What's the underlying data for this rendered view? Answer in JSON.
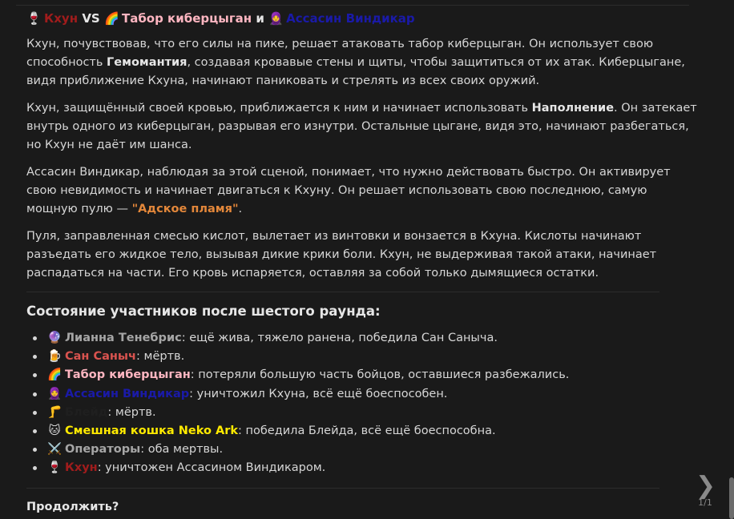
{
  "header": {
    "icon1": "🍷",
    "name1": "Кхун",
    "vs": "VS",
    "icon2": "🌈",
    "name2": "Табор киберцыган",
    "and": "и",
    "icon3": "🧕",
    "name3": "Ассасин Виндикар"
  },
  "paragraphs": {
    "p1_a": "Кхун, почувствовав, что его силы на пике, решает атаковать табор киберцыган. Он использует свою способность ",
    "p1_b": "Гемомантия",
    "p1_c": ", создавая кровавые стены и щиты, чтобы защититься от их атак. Киберцыгане, видя приближение Кхуна, начинают паниковать и стрелять из всех своих оружий.",
    "p2_a": "Кхун, защищённый своей кровью, приближается к ним и начинает использовать ",
    "p2_b": "Наполнение",
    "p2_c": ". Он затекает внутрь одного из киберцыган, разрывая его изнутри. Остальные цыгане, видя это, начинают разбегаться, но Кхун не даёт им шанса.",
    "p3_a": "Ассасин Виндикар, наблюдая за этой сценой, понимает, что нужно действовать быстро. Он активирует свою невидимость и начинает двигаться к Кхуну. Он решает использовать свою последнюю, самую мощную пулю — ",
    "p3_b": "\"Адское пламя\"",
    "p3_c": ".",
    "p4": "Пуля, заправленная смесью кислот, вылетает из винтовки и вонзается в Кхуна. Кислоты начинают разъедать его жидкое тело, вызывая дикие крики боли. Кхун, не выдерживая такой атаки, начинает распадаться на части. Его кровь испаряется, оставляя за собой только дымящиеся остатки."
  },
  "status": {
    "title": "Состояние участников после шестого раунда:",
    "items": [
      {
        "icon": "🔮",
        "name": "Лианна Тенебрис",
        "text": ": ещё жива, тяжело ранена, победила Сан Саныча."
      },
      {
        "icon": "🍺",
        "name": "Сан Саныч",
        "text": ": мёртв."
      },
      {
        "icon": "🌈",
        "name": "Табор киберцыган",
        "text": ": потеряли большую часть бойцов, оставшиеся разбежались."
      },
      {
        "icon": "🧕",
        "name": "Ассасин Виндикар",
        "text": ": уничтожил Кхуна, всё ещё боеспособен."
      },
      {
        "icon": "🦵",
        "name": "Блейд",
        "text": ": мёртв."
      },
      {
        "icon": "🐱",
        "name": "Смешная кошка Neko Ark",
        "text": ": победила Блейда, всё ещё боеспособна."
      },
      {
        "icon": "⚔️",
        "name": "Операторы",
        "text": ": оба мертвы."
      },
      {
        "icon": "🍷",
        "name": "Кхун",
        "text": ": уничтожен Ассасином Виндикаром."
      }
    ]
  },
  "continue_text": "Продолжить?",
  "pager": {
    "arrow": "❯",
    "count": "1/1"
  },
  "colors": {
    "khun": "#a01c1c",
    "tabor": "#ffb6c1",
    "assassin": "#1a1aa8",
    "lianna": "#a6a6a6",
    "san": "#d9534f",
    "neko": "#ffea00",
    "blade": "#1f1f1f",
    "operators": "#a6a6a6",
    "accent_orange": "#e3873a"
  }
}
